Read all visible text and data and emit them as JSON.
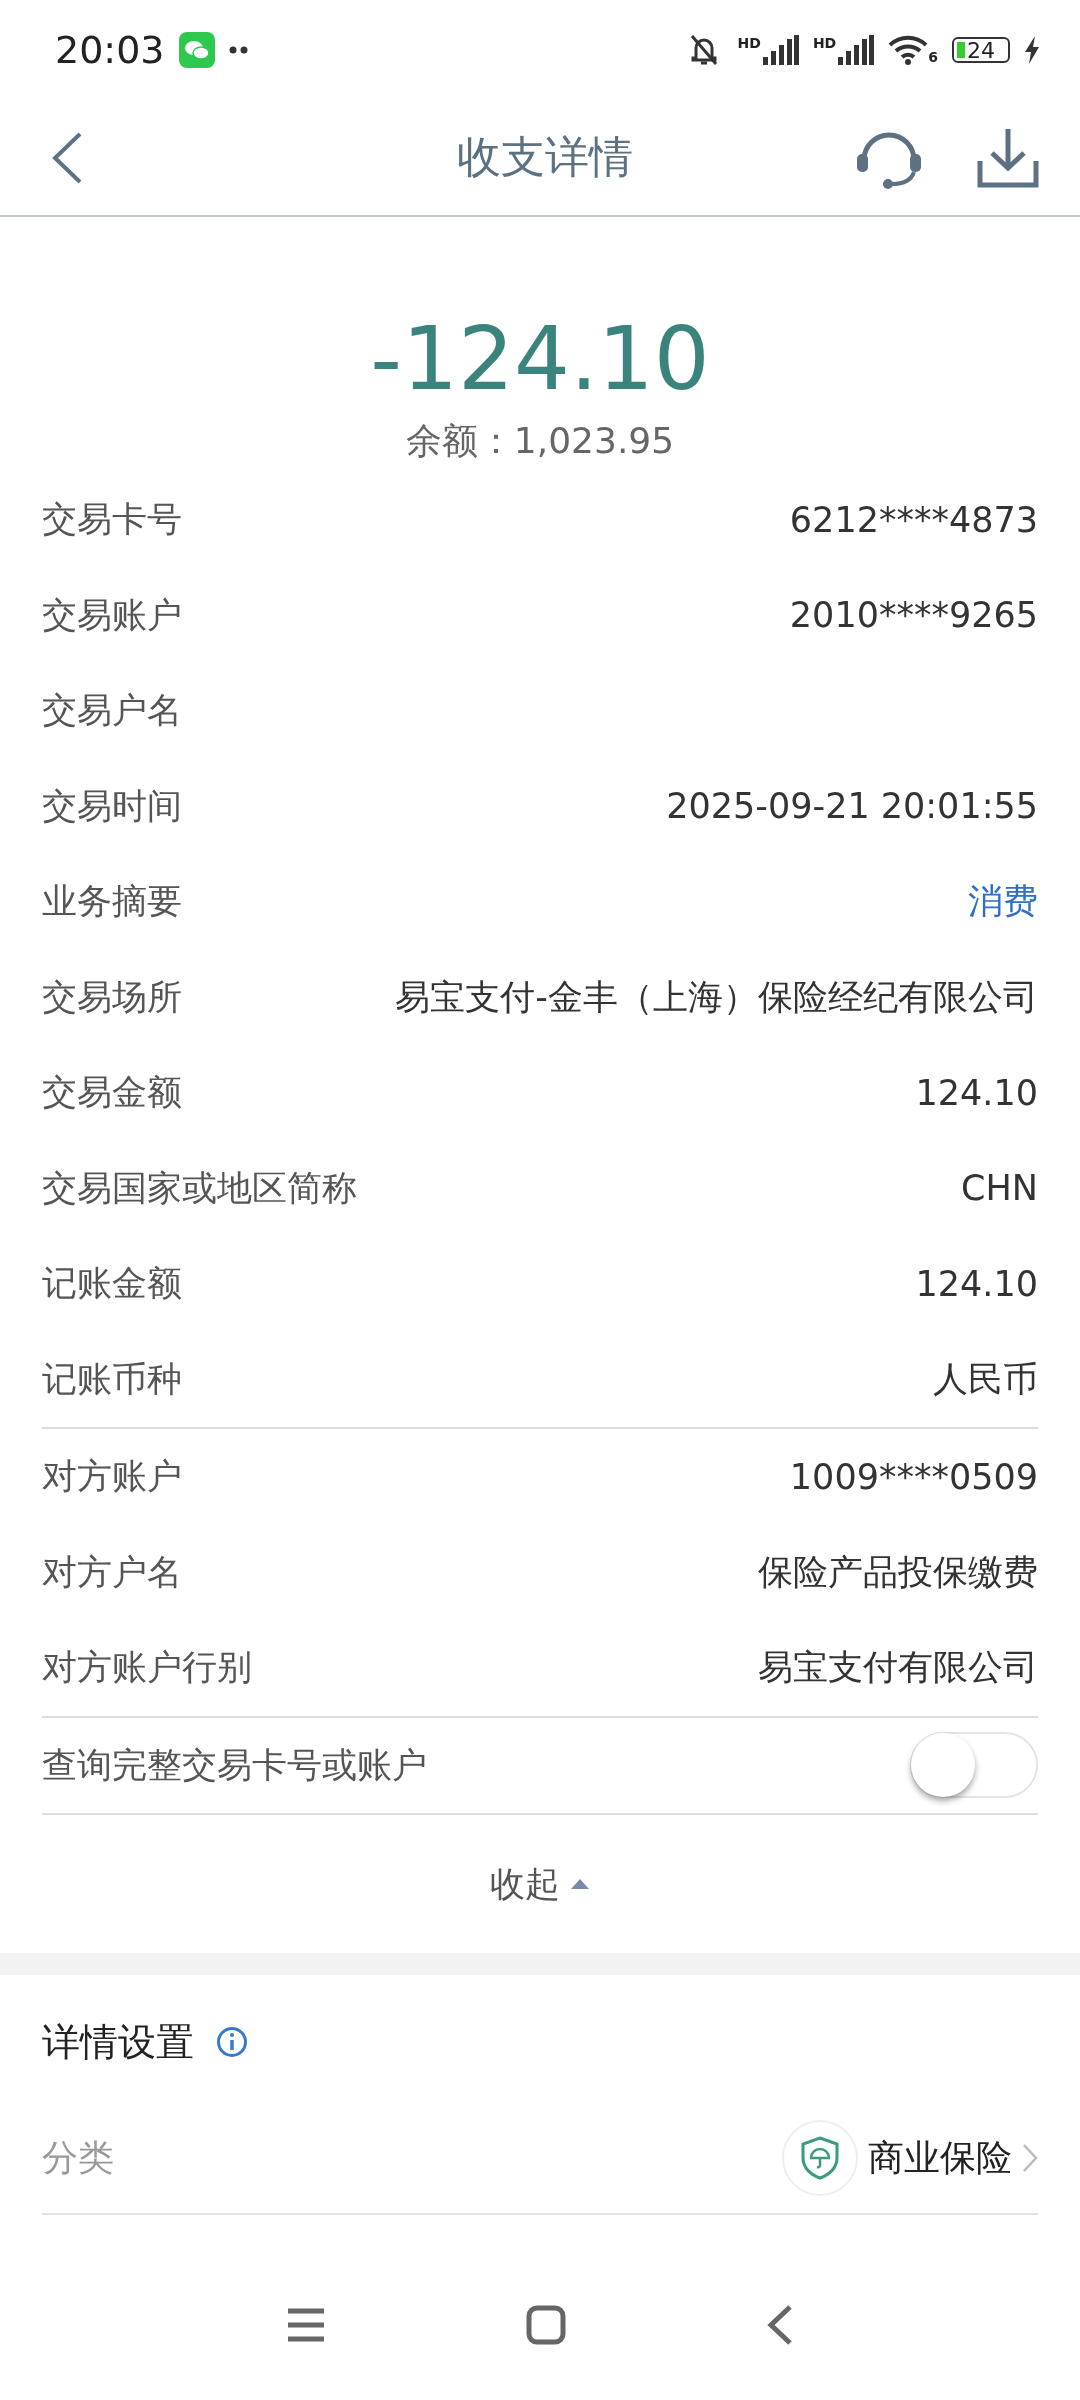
{
  "status_bar": {
    "time": "20:03",
    "signal_labels": [
      "HD",
      "HD"
    ],
    "wifi_label": "6",
    "battery": "24"
  },
  "header": {
    "title": "收支详情"
  },
  "summary": {
    "amount": "-124.10",
    "balance": "余额：1,023.95"
  },
  "groups": [
    {
      "rows": [
        {
          "label": "交易卡号",
          "value": "6212****4873",
          "kind": "text"
        },
        {
          "label": "交易账户",
          "value": "2010****9265",
          "kind": "text"
        },
        {
          "label": "交易户名"
        },
        {
          "label": "交易时间",
          "value": "2025-09-21 20:01:55",
          "kind": "text"
        },
        {
          "label": "业务摘要",
          "value": "消费",
          "kind": "link"
        },
        {
          "label": "交易场所",
          "value": "易宝支付-金丰（上海）保险经纪有限公司",
          "kind": "text"
        },
        {
          "label": "交易金额",
          "value": "124.10",
          "kind": "text"
        },
        {
          "label": "交易国家或地区简称",
          "value": "CHN",
          "kind": "text"
        },
        {
          "label": "记账金额",
          "value": "124.10",
          "kind": "text"
        },
        {
          "label": "记账币种",
          "value": "人民币",
          "kind": "text"
        }
      ]
    },
    {
      "rows": [
        {
          "label": "对方账户",
          "value": "1009****0509",
          "kind": "text"
        },
        {
          "label": "对方户名",
          "value": "保险产品投保缴费",
          "kind": "text"
        },
        {
          "label": "对方账户行别",
          "value": "易宝支付有限公司",
          "kind": "text"
        }
      ]
    }
  ],
  "full_number_toggle": {
    "label": "查询完整交易卡号或账户",
    "on": false
  },
  "collapse": {
    "label": "收起",
    "expanded": true
  },
  "settings": {
    "title": "详情设置",
    "category_label": "分类",
    "category_value": "商业保险"
  }
}
